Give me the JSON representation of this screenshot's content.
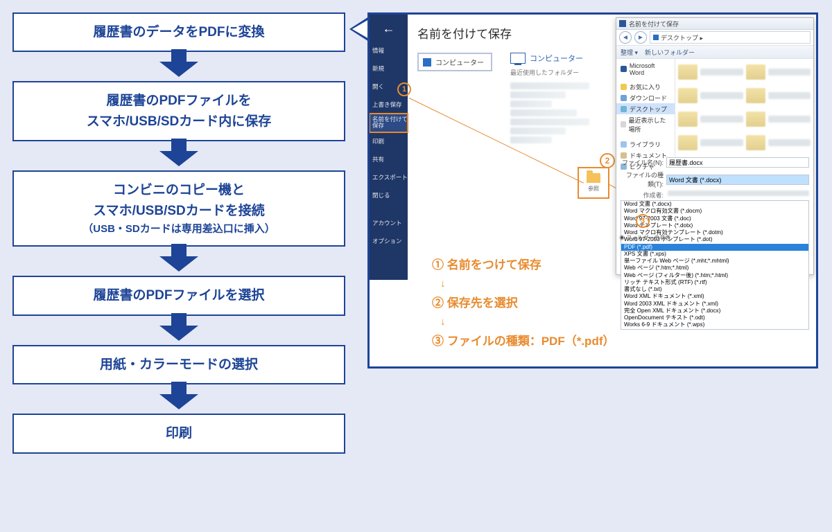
{
  "flow": {
    "step1": "履歴書のデータをPDFに変換",
    "step2a": "履歴書のPDFファイルを",
    "step2b": "スマホ/USB/SDカード内に保存",
    "step3a": "コンビニのコピー機と",
    "step3b": "スマホ/USB/SDカードを接続",
    "step3c": "（USB・SDカードは専用差込口に挿入）",
    "step4": "履歴書のPDFファイルを選択",
    "step5": "用紙・カラーモードの選択",
    "step6": "印刷"
  },
  "word": {
    "nav": {
      "info": "情報",
      "new": "新規",
      "open": "開く",
      "save": "上書き保存",
      "saveas1": "名前を付けて",
      "saveas2": "保存",
      "print": "印刷",
      "share": "共有",
      "export": "エクスポート",
      "close": "閉じる",
      "account": "アカウント",
      "options": "オプション"
    },
    "title": "名前を付けて保存",
    "location": "コンピューター",
    "location_hdr": "コンピューター",
    "recent_hdr": "最近使用したフォルダー",
    "browse": "参照"
  },
  "dialog": {
    "title": "名前を付けて保存",
    "crumb": "デスクトップ ▸",
    "tool_org": "整理 ▾",
    "tool_new": "新しいフォルダー",
    "side": {
      "word": "Microsoft Word",
      "fav": "お気に入り",
      "dl": "ダウンロード",
      "desktop": "デスクトップ",
      "recent": "最近表示した場所",
      "library": "ライブラリ",
      "doc": "ドキュメント",
      "pic": "ピクチャ"
    },
    "file_label": "ファイル名(N):",
    "file_value": "履歴書.docx",
    "type_label": "ファイルの種類(T):",
    "type_value": "Word 文書 (*.docx)",
    "author_label": "作成者:",
    "opts": [
      "Word 文書 (*.docx)",
      "Word マクロ有効文書 (*.docm)",
      "Word 97-2003 文書 (*.doc)",
      "Word テンプレート (*.dotx)",
      "Word マクロ有効テンプレート (*.dotm)",
      "Word 97-2003 テンプレート (*.dot)",
      "PDF (*.pdf)",
      "XPS 文書 (*.xps)",
      "単一ファイル Web ページ (*.mht;*.mhtml)",
      "Web ページ (*.htm;*.html)",
      "Web ページ (フィルター後) (*.htm;*.html)",
      "リッチ テキスト形式 (RTF) (*.rtf)",
      "書式なし (*.txt)",
      "Word XML ドキュメント (*.xml)",
      "Word 2003 XML ドキュメント (*.xml)",
      "完全 Open XML ドキュメント (*.docx)",
      "OpenDocument テキスト (*.odt)",
      "Works 6-9 ドキュメント (*.wps)"
    ],
    "folder_toggle": "◉ フォルダーの非表"
  },
  "markers": {
    "m1": "1",
    "m2": "2",
    "m3": "3"
  },
  "ann": {
    "l1": "① 名前をつけて保存",
    "l2": "② 保存先を選択",
    "l3": "③ ファイルの種類：PDF（*.pdf）"
  }
}
